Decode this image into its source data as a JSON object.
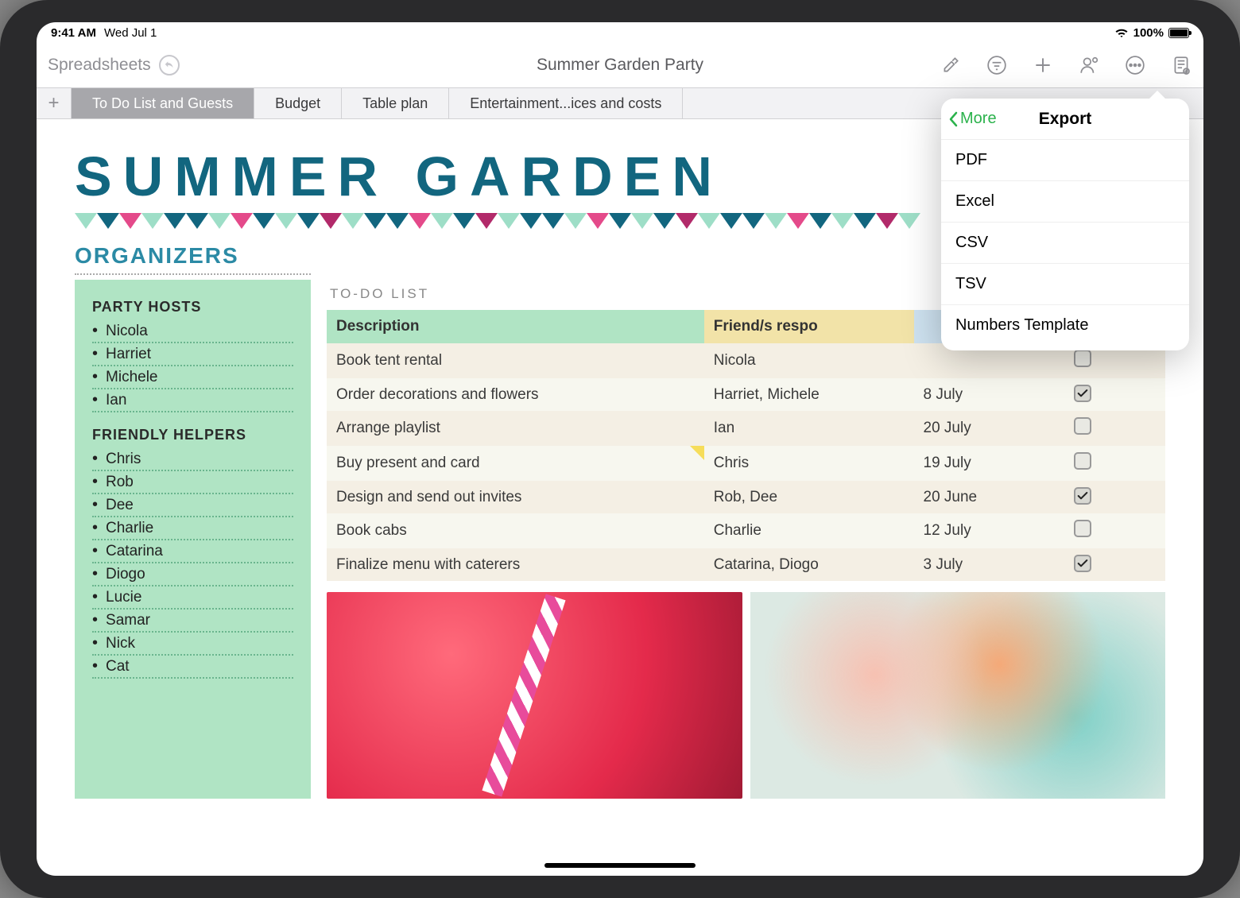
{
  "status": {
    "time": "9:41 AM",
    "date": "Wed Jul 1",
    "battery": "100%"
  },
  "toolbar": {
    "back": "Spreadsheets",
    "title": "Summer Garden Party"
  },
  "tabs": [
    "To Do List and Guests",
    "Budget",
    "Table plan",
    "Entertainment...ices and costs"
  ],
  "doc": {
    "title": "SUMMER GARDEN",
    "organizers_header": "ORGANIZERS",
    "hosts_header": "PARTY HOSTS",
    "hosts": [
      "Nicola",
      "Harriet",
      "Michele",
      "Ian"
    ],
    "helpers_header": "FRIENDLY HELPERS",
    "helpers": [
      "Chris",
      "Rob",
      "Dee",
      "Charlie",
      "Catarina",
      "Diogo",
      "Lucie",
      "Samar",
      "Nick",
      "Cat"
    ],
    "todo_header": "TO-DO LIST",
    "todo_columns": [
      "Description",
      "Friend/s respo",
      "",
      ""
    ],
    "todo_rows": [
      {
        "desc": "Book tent rental",
        "who": "Nicola",
        "when": "",
        "done": false
      },
      {
        "desc": "Order decorations and flowers",
        "who": "Harriet, Michele",
        "when": "8 July",
        "done": true
      },
      {
        "desc": "Arrange playlist",
        "who": "Ian",
        "when": "20 July",
        "done": false
      },
      {
        "desc": "Buy present and card",
        "who": "Chris",
        "when": "19 July",
        "done": false,
        "fold": true
      },
      {
        "desc": "Design and send out invites",
        "who": "Rob, Dee",
        "when": "20 June",
        "done": true
      },
      {
        "desc": "Book cabs",
        "who": "Charlie",
        "when": "12 July",
        "done": false
      },
      {
        "desc": "Finalize menu with caterers",
        "who": "Catarina, Diogo",
        "when": "3 July",
        "done": true
      }
    ]
  },
  "popover": {
    "back": "More",
    "title": "Export",
    "items": [
      "PDF",
      "Excel",
      "CSV",
      "TSV",
      "Numbers Template"
    ]
  },
  "bunting_colors": [
    "#9edec7",
    "#12667f",
    "#e44a8a",
    "#9edec7",
    "#12667f",
    "#12667f",
    "#9edec7",
    "#e44a8a",
    "#12667f",
    "#9edec7",
    "#12667f",
    "#b22a6a",
    "#9edec7",
    "#12667f",
    "#12667f",
    "#e44a8a",
    "#9edec7",
    "#12667f",
    "#b22a6a",
    "#9edec7",
    "#12667f",
    "#12667f",
    "#9edec7",
    "#e44a8a",
    "#12667f",
    "#9edec7",
    "#12667f",
    "#b22a6a",
    "#9edec7",
    "#12667f",
    "#12667f",
    "#9edec7",
    "#e44a8a",
    "#12667f",
    "#9edec7",
    "#12667f",
    "#b22a6a",
    "#9edec7"
  ]
}
